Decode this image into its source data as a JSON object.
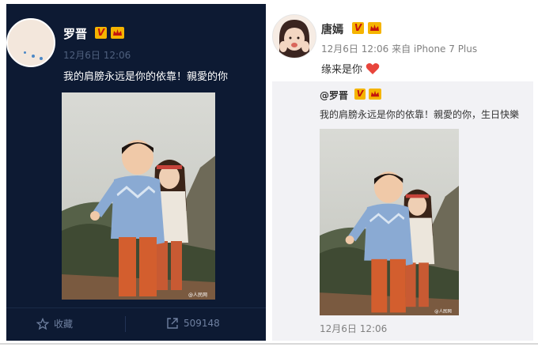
{
  "left_post": {
    "author": "罗晋",
    "badge_v": "V",
    "time": "12月6日 12:06",
    "text": "我的肩膀永远是你的依靠！親愛的你",
    "actions": {
      "favorite_label": "收藏",
      "repost_count": "509148"
    }
  },
  "right_post": {
    "author": "唐嫣",
    "badge_v": "V",
    "meta": "12月6日 12:06 来自 iPhone 7 Plus",
    "text": "缘来是你",
    "repost": {
      "author": "@罗晋",
      "badge_v": "V",
      "text": "我的肩膀永远是你的依靠！親愛的你，生日快樂",
      "time": "12月6日 12:06"
    }
  },
  "colors": {
    "left_bg": "#0d1a33",
    "badge_gold": "#f5b400",
    "heart": "#e8453c"
  },
  "icons": [
    "star-icon",
    "repost-icon",
    "heart-icon",
    "crown-badge-icon",
    "verified-badge-icon"
  ]
}
